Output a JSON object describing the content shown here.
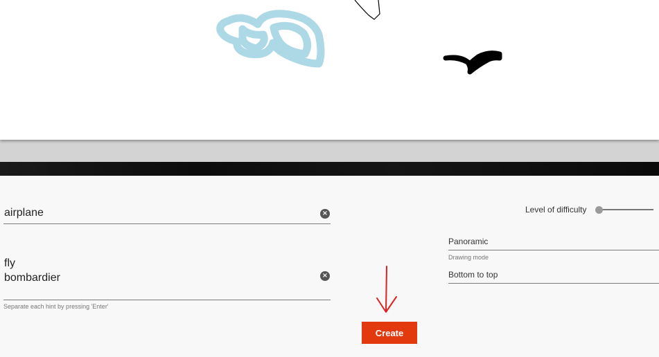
{
  "drawing_canvas": {
    "background": "#ffffff",
    "strokes": [
      {
        "name": "light-blue-cloud-stroke",
        "color": "#add8e6"
      },
      {
        "name": "black-thin-outline-stroke",
        "color": "#000000"
      },
      {
        "name": "black-bird-stroke",
        "color": "#000000"
      }
    ]
  },
  "form": {
    "word": {
      "value": "airplane",
      "clear_icon": "close-circle-icon"
    },
    "hints": {
      "lines": [
        "fly",
        "bombardier"
      ],
      "help_text": "Separate each hint by pressing 'Enter'",
      "clear_icon": "close-circle-icon"
    },
    "difficulty": {
      "label": "Level of difficulty",
      "level": 0
    },
    "drawing_mode": {
      "value": "Panoramic",
      "label": "Drawing mode"
    },
    "direction": {
      "value": "Bottom to top"
    },
    "create_button": {
      "label": "Create",
      "color": "#e23a0e"
    },
    "annotation_arrow": {
      "color": "#e02020"
    }
  }
}
